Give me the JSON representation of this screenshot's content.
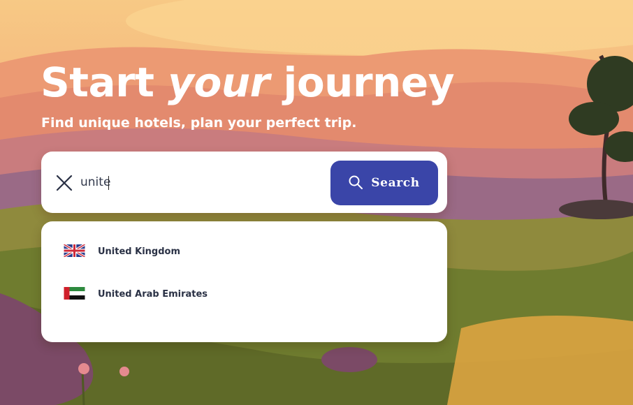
{
  "hero": {
    "title_start": "Start",
    "title_em": "your",
    "title_end": "journey",
    "subtitle": "Find unique hotels, plan your perfect trip."
  },
  "search": {
    "value": "unite",
    "button_label": "Search"
  },
  "suggestions": [
    {
      "label": "United Kingdom",
      "flag": "uk-flag"
    },
    {
      "label": "United Arab Emirates",
      "flag": "uae-flag"
    }
  ],
  "colors": {
    "accent": "#3a45a8",
    "text_dark": "#2a3145"
  }
}
